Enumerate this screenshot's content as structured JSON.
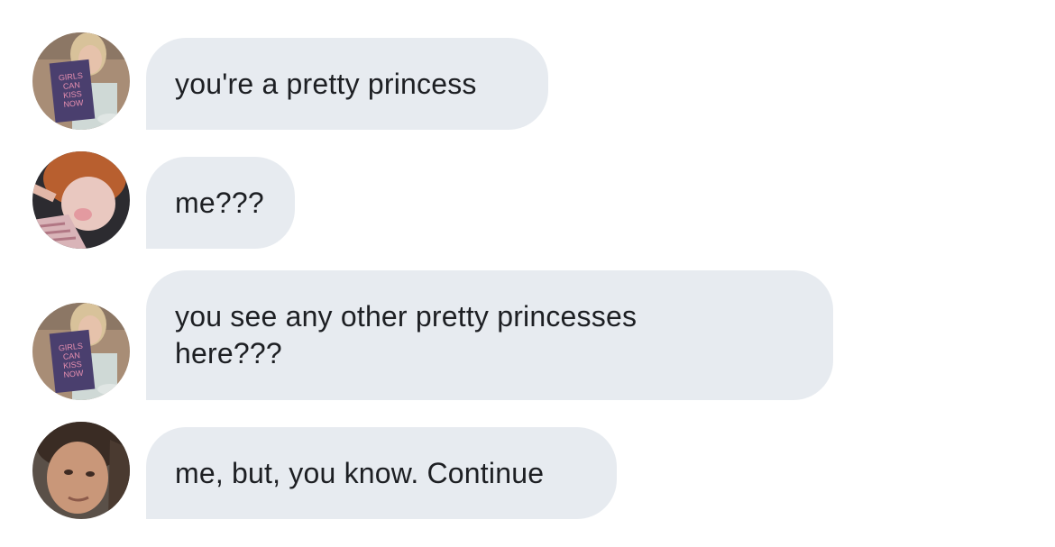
{
  "conversation": {
    "messages": [
      {
        "sender_avatar": "avatar-girl-reading-book",
        "text": "you're a pretty princess"
      },
      {
        "sender_avatar": "avatar-redhead",
        "text": "me???"
      },
      {
        "sender_avatar": "avatar-girl-reading-book",
        "text": "you see any other pretty princesses\nhere???"
      },
      {
        "sender_avatar": "avatar-young-man",
        "text": "me, but, you know. Continue"
      }
    ]
  },
  "book_cover": {
    "title_lines": [
      "GIRLS",
      "CAN",
      "KISS",
      "NOW"
    ]
  },
  "colors": {
    "bubble_bg": "#e7ebf0",
    "text": "#1d1f23"
  }
}
